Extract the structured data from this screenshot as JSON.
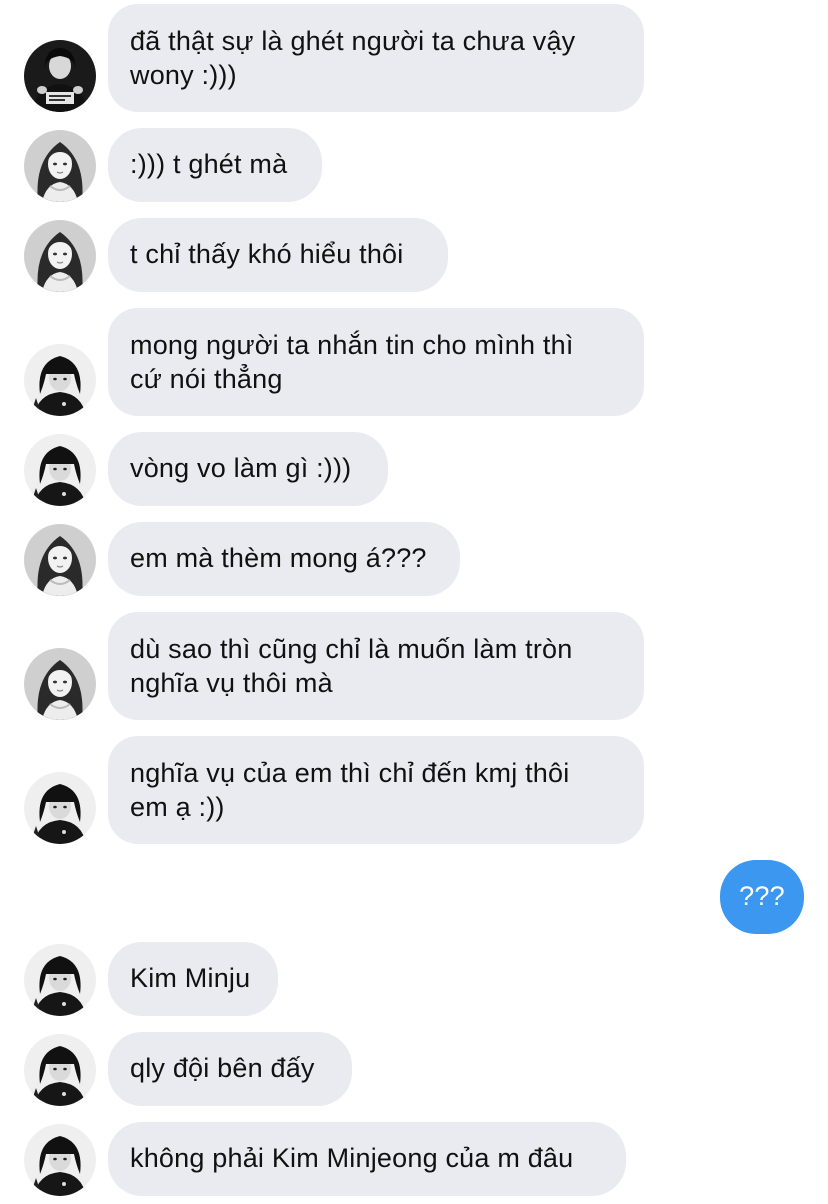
{
  "messages": [
    {
      "from": "friend",
      "avatar": "bw-avatar-shirt",
      "text": "đã thật sự là ghét người ta chưa vậy\nwony :)))"
    },
    {
      "from": "wonyoung",
      "avatar": "bw-avatar-portrait",
      "text": ":))) t ghét mà"
    },
    {
      "from": "wonyoung",
      "avatar": "bw-avatar-portrait",
      "text": "t chỉ thấy khó hiểu thôi"
    },
    {
      "from": "other",
      "avatar": "bw-avatar-bangs",
      "text": "mong người ta nhắn tin cho mình thì\ncứ nói thẳng"
    },
    {
      "from": "other",
      "avatar": "bw-avatar-bangs",
      "text": "vòng vo làm gì :)))"
    },
    {
      "from": "wonyoung",
      "avatar": "bw-avatar-portrait",
      "text": "em mà thèm mong á???"
    },
    {
      "from": "wonyoung",
      "avatar": "bw-avatar-portrait",
      "text": "dù sao thì cũng chỉ là muốn làm tròn\nnghĩa vụ thôi mà"
    },
    {
      "from": "other",
      "avatar": "bw-avatar-bangs",
      "text": "nghĩa vụ của em thì chỉ đến kmj thôi\nem ạ :))"
    },
    {
      "from": "self",
      "avatar": "",
      "text": "???"
    },
    {
      "from": "other",
      "avatar": "bw-avatar-bangs",
      "text": "Kim Minju"
    },
    {
      "from": "other",
      "avatar": "bw-avatar-bangs",
      "text": "qly đội bên đấy"
    },
    {
      "from": "other",
      "avatar": "bw-avatar-bangs",
      "text": "không phải Kim Minjeong của m đâu"
    }
  ],
  "colors": {
    "incoming_bubble": "#e9ebf0",
    "outgoing_bubble": "#3b97f0",
    "incoming_text": "#111111",
    "outgoing_text": "#ffffff"
  }
}
